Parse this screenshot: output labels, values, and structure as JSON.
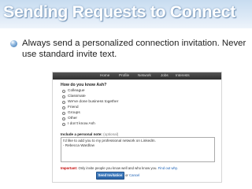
{
  "slide": {
    "title": "Sending Requests to Connect",
    "bullet": "Always send a personalized connection invitation.  Never use standard invite text."
  },
  "screenshot": {
    "nav": [
      "Home",
      "Profile",
      "Network",
      "Jobs",
      "Interests"
    ],
    "question": "How do you know Ash?",
    "options": [
      "Colleague",
      "Classmate",
      "We've done business together",
      "Friend",
      "Groups",
      "Other",
      "I don't know Ash"
    ],
    "note_label": "Include a personal note:",
    "note_optional": "(optional)",
    "note_line1": "I'd like to add you to my professional network on LinkedIn.",
    "note_line2": "- Rebecca Wardlow",
    "important_label": "Important:",
    "important_text": " Only invite people you know well and who know you. ",
    "important_link": "Find out why.",
    "send_button": "Send Invitation",
    "or_text": "or ",
    "cancel_link": "Cancel"
  },
  "colors": {
    "title_band": "#c7dcf0",
    "nav_bar": "#3a3a3a",
    "send_button": "#2f6fb3",
    "important": "#c00000",
    "link": "#1a5fb4"
  }
}
